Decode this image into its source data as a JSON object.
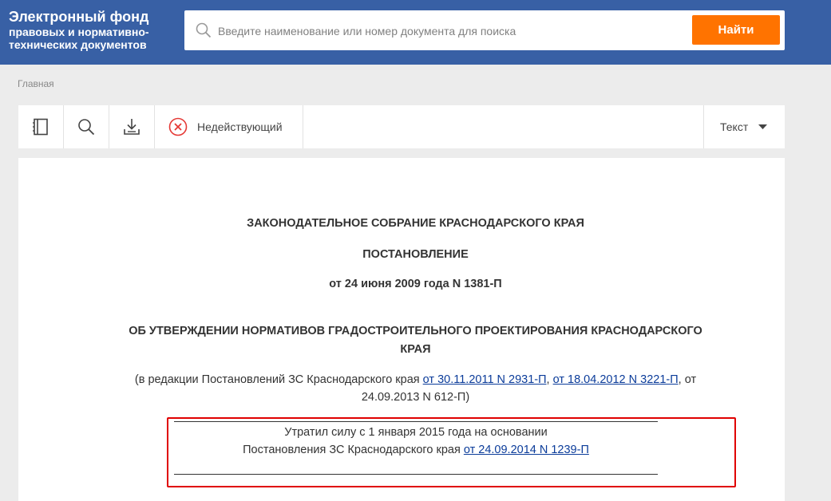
{
  "header": {
    "logo_line1": "Электронный фонд",
    "logo_line2": "правовых и нормативно-",
    "logo_line3": "технических документов"
  },
  "search": {
    "placeholder": "Введите наименование или номер документа для поиска",
    "button_label": "Найти"
  },
  "breadcrumb": "Главная",
  "toolbar": {
    "icons": [
      "book-icon",
      "search-icon",
      "download-icon",
      "invalid-status-icon",
      "chevron-down-icon"
    ],
    "status_label": "Недействующий",
    "view_label": "Текст"
  },
  "document": {
    "authority": "ЗАКОНОДАТЕЛЬНОЕ СОБРАНИЕ КРАСНОДАРСКОГО КРАЯ",
    "type": "ПОСТАНОВЛЕНИЕ",
    "date_number": "от 24 июня 2009 года N 1381-П",
    "title_line1": "ОБ УТВЕРЖДЕНИИ НОРМАТИВОВ ГРАДОСТРОИТЕЛЬНОГО ПРОЕКТИРОВАНИЯ КРАСНОДАРСКОГО",
    "title_line2": "КРАЯ",
    "revision_prefix": "(в редакции Постановлений ЗС Краснодарского края ",
    "revision_link1": "от 30.11.2011 N 2931-П",
    "revision_sep": ", ",
    "revision_link2": "от 18.04.2012 N 3221-П",
    "revision_suffix": ", от",
    "revision_line2": "24.09.2013 N 612-П)",
    "notice_line1": "Утратил силу с 1 января 2015 года на основании",
    "notice_line2_prefix": "Постановления ЗС Краснодарского края ",
    "notice_link": "от 24.09.2014 N 1239-П"
  },
  "colors": {
    "header_bg": "#3860a5",
    "search_button": "#ff7300",
    "invalid_status": "#e53935",
    "highlight_border": "#e00000",
    "link": "#0b3c9a"
  }
}
